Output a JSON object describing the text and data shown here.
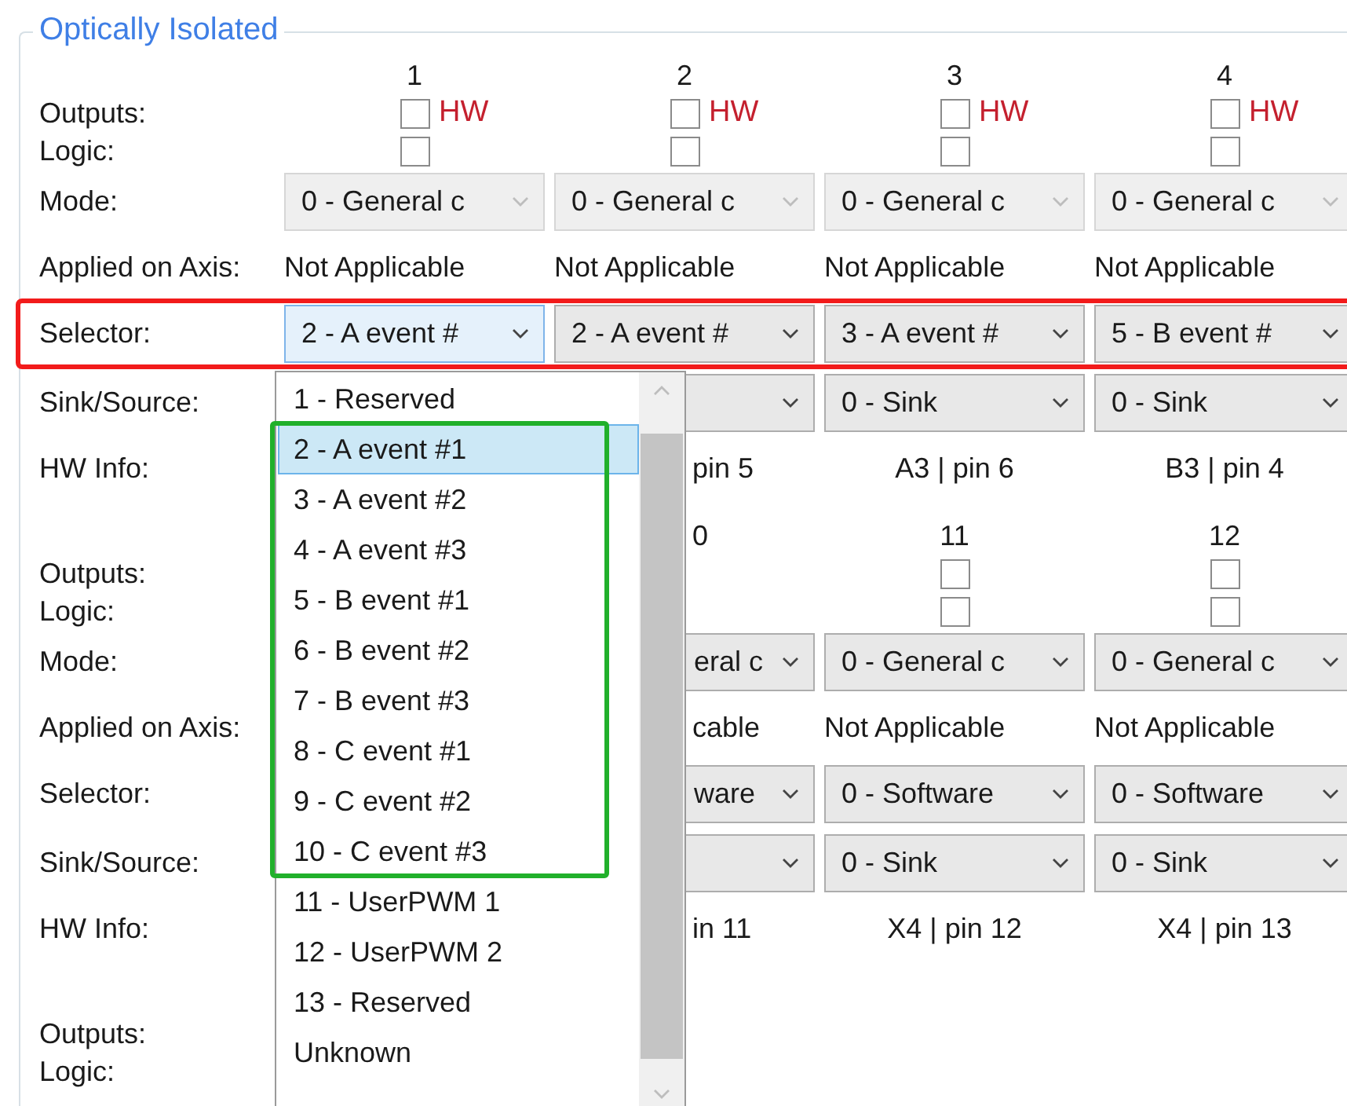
{
  "title": "Optically Isolated",
  "groups": [
    {
      "labels": [
        "Outputs:",
        "Logic:",
        "Mode:",
        "Applied on Axis:",
        "Selector:",
        "Sink/Source:",
        "HW Info:"
      ],
      "selector_marked": true,
      "columns": [
        {
          "number": "1",
          "outputs": {
            "checked": false,
            "tag": "HW"
          },
          "logic": {
            "checked": false
          },
          "mode": {
            "value": "0 - General c",
            "disabled": true
          },
          "axis": "Not Applicable",
          "selector": {
            "value": "2 - A event #",
            "focused": true
          }
        },
        {
          "number": "2",
          "outputs": {
            "checked": false,
            "tag": "HW"
          },
          "logic": {
            "checked": false
          },
          "mode": {
            "value": "0 - General c",
            "disabled": true
          },
          "axis": "Not Applicable",
          "selector": {
            "value": "2 - A event #",
            "focused": false
          },
          "sink": {
            "kind": "combo"
          },
          "hw_info": {
            "text": "pin 5",
            "partly_covered": true
          }
        },
        {
          "number": "3",
          "outputs": {
            "checked": false,
            "tag": "HW"
          },
          "logic": {
            "checked": false
          },
          "mode": {
            "value": "0 - General c",
            "disabled": true
          },
          "axis": "Not Applicable",
          "selector": {
            "value": "3 - A event #",
            "focused": false
          },
          "sink": {
            "value": "0 - Sink"
          },
          "hw_info": {
            "text": "A3 | pin 6"
          }
        },
        {
          "number": "4",
          "outputs": {
            "checked": false,
            "tag": "HW"
          },
          "logic": {
            "checked": false
          },
          "mode": {
            "value": "0 - General c",
            "disabled": true
          },
          "axis": "Not Applicable",
          "selector": {
            "value": "5 - B event #",
            "focused": false
          },
          "sink": {
            "value": "0 - Sink"
          },
          "hw_info": {
            "text": "B3 | pin 4"
          }
        }
      ]
    },
    {
      "labels": [
        "Outputs:",
        "Logic:",
        "Mode:",
        "Applied on Axis:",
        "Selector:",
        "Sink/Source:",
        "HW Info:"
      ],
      "columns": [
        {
          "number": "0",
          "partly_covered": true,
          "mode": {
            "value": "eral c"
          },
          "axis": "cable",
          "selector": {
            "value": "ware"
          },
          "sink": {
            "kind": "combo"
          },
          "hw_info": {
            "text": "in 11"
          }
        },
        {
          "number": "11",
          "outputs": {
            "checked": false
          },
          "logic": {
            "checked": false
          },
          "mode": {
            "value": "0 - General c",
            "disabled": false
          },
          "axis": "Not Applicable",
          "selector": {
            "value": "0 - Software",
            "focused": false
          },
          "sink": {
            "value": "0 - Sink"
          },
          "hw_info": {
            "text": "X4 | pin 12"
          }
        },
        {
          "number": "12",
          "outputs": {
            "checked": false
          },
          "logic": {
            "checked": false
          },
          "mode": {
            "value": "0 - General c",
            "disabled": false
          },
          "axis": "Not Applicable",
          "selector": {
            "value": "0 - Software",
            "focused": false
          },
          "sink": {
            "value": "0 - Sink"
          },
          "hw_info": {
            "text": "X4 | pin 13"
          }
        }
      ]
    },
    {
      "labels": [
        "Outputs:",
        "Logic:"
      ]
    }
  ],
  "dropdown": {
    "items": [
      {
        "label": "1 - Reserved",
        "selected": false,
        "outlined": false
      },
      {
        "label": "2 - A event #1",
        "selected": true,
        "outlined": true
      },
      {
        "label": "3 - A event #2",
        "selected": false,
        "outlined": true
      },
      {
        "label": "4 - A event #3",
        "selected": false,
        "outlined": true
      },
      {
        "label": "5 - B event #1",
        "selected": false,
        "outlined": true
      },
      {
        "label": "6 - B event #2",
        "selected": false,
        "outlined": true
      },
      {
        "label": "7 - B event #3",
        "selected": false,
        "outlined": true
      },
      {
        "label": "8 - C event #1",
        "selected": false,
        "outlined": true
      },
      {
        "label": "9 - C event #2",
        "selected": false,
        "outlined": true
      },
      {
        "label": "10 - C event #3",
        "selected": false,
        "outlined": true
      },
      {
        "label": "11 - UserPWM 1",
        "selected": false,
        "outlined": false
      },
      {
        "label": "12 - UserPWM 2",
        "selected": false,
        "outlined": false
      },
      {
        "label": "13 - Reserved",
        "selected": false,
        "outlined": false
      },
      {
        "label": "Unknown",
        "selected": false,
        "outlined": false
      }
    ]
  }
}
